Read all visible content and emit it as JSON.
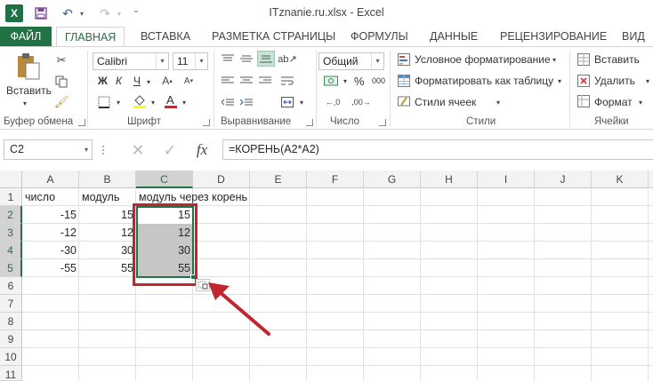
{
  "window": {
    "title": "ITznanie.ru.xlsx - Excel",
    "app_icon_letter": "X"
  },
  "tabs": [
    {
      "label": "ФАЙЛ"
    },
    {
      "label": "ГЛАВНАЯ"
    },
    {
      "label": "ВСТАВКА"
    },
    {
      "label": "РАЗМЕТКА СТРАНИЦЫ"
    },
    {
      "label": "ФОРМУЛЫ"
    },
    {
      "label": "ДАННЫЕ"
    },
    {
      "label": "РЕЦЕНЗИРОВАНИЕ"
    },
    {
      "label": "ВИД"
    }
  ],
  "ribbon": {
    "clipboard": {
      "paste_label": "Вставить",
      "group_label": "Буфер обмена"
    },
    "font": {
      "font_name": "Calibri",
      "font_size": "11",
      "bold": "Ж",
      "italic": "К",
      "underline": "Ч",
      "group_label": "Шрифт"
    },
    "alignment": {
      "group_label": "Выравнивание"
    },
    "number": {
      "format": "Общий",
      "percent": "%",
      "thousands": "000",
      "group_label": "Число"
    },
    "styles": {
      "conditional": "Условное форматирование",
      "as_table": "Форматировать как таблицу",
      "cell_styles": "Стили ячеек",
      "group_label": "Стили"
    },
    "cells": {
      "insert": "Вставить",
      "delete": "Удалить",
      "format": "Формат",
      "group_label": "Ячейки"
    }
  },
  "formula_bar": {
    "name_box": "C2",
    "fx": "fx",
    "formula": "=КОРЕНЬ(A2*A2)"
  },
  "grid": {
    "columns": [
      "A",
      "B",
      "C",
      "D",
      "E",
      "F",
      "G",
      "H",
      "I",
      "J",
      "K"
    ],
    "rows": [
      "1",
      "2",
      "3",
      "4",
      "5",
      "6",
      "7",
      "8",
      "9",
      "10",
      "11"
    ],
    "headers": {
      "a1": "число",
      "b1": "модуль",
      "c1": "модуль через корень"
    },
    "data": [
      {
        "a": "-15",
        "b": "15",
        "c": "15"
      },
      {
        "a": "-12",
        "b": "12",
        "c": "12"
      },
      {
        "a": "-30",
        "b": "30",
        "c": "30"
      },
      {
        "a": "-55",
        "b": "55",
        "c": "55"
      }
    ]
  },
  "colors": {
    "excel_green": "#217346",
    "highlight_red": "#c0262d",
    "selection_gray": "#c6c6c6"
  }
}
